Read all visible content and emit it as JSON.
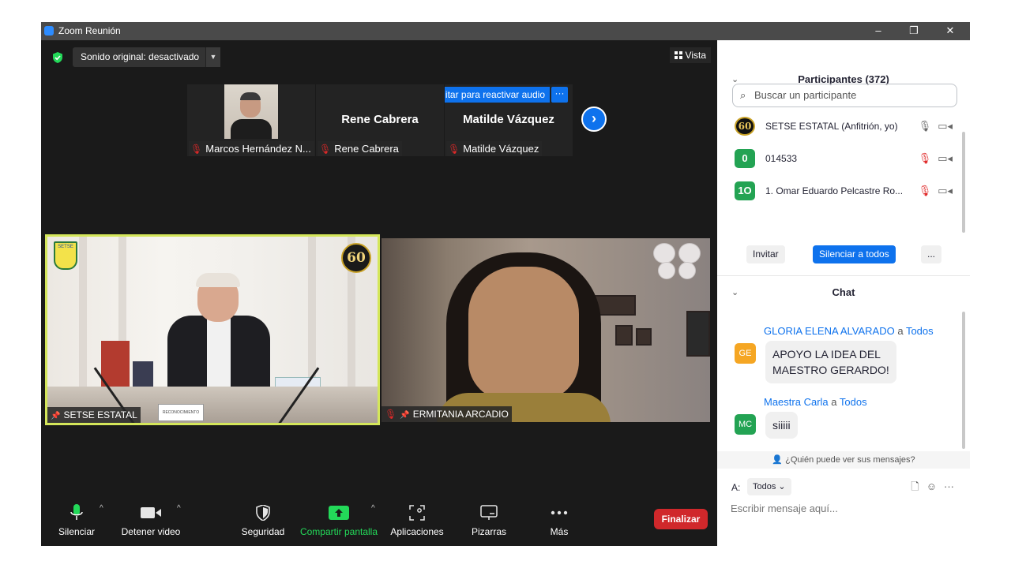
{
  "window": {
    "title": "Zoom Reunión",
    "controls": [
      "–",
      "❐",
      "✕"
    ]
  },
  "meeting": {
    "sound_button": "Sonido original: desactivado",
    "view_button": "Vista",
    "unmute_banner": "itar para reactivar audio",
    "more": "···",
    "thumbnails": [
      {
        "label": "Marcos Hernández N...",
        "big_name": ""
      },
      {
        "label": "Rene Cabrera",
        "big_name": "Rene Cabrera"
      },
      {
        "label": "Matilde Vázquez",
        "big_name": "Matilde Vázquez"
      }
    ],
    "videos": [
      {
        "label": "SETSE ESTATAL",
        "badge": "60",
        "logo_text": "SETSE",
        "poster_text": "RECONOCIMIENTO"
      },
      {
        "label": "ERMITANIA ARCADIO"
      }
    ]
  },
  "toolbar": {
    "items": [
      {
        "label": "Silenciar",
        "icon": "microphone-icon"
      },
      {
        "label": "Detener video",
        "icon": "video-camera-icon"
      },
      {
        "label": "Seguridad",
        "icon": "shield-icon"
      },
      {
        "label": "Compartir pantalla",
        "icon": "share-screen-icon"
      },
      {
        "label": "Aplicaciones",
        "icon": "apps-icon"
      },
      {
        "label": "Pizarras",
        "icon": "whiteboard-icon"
      },
      {
        "label": "Más",
        "icon": "more-icon"
      }
    ],
    "end_button": "Finalizar",
    "share_color": "#23d959",
    "end_color": "#d0282b"
  },
  "participants": {
    "title": "Participantes (372)",
    "search_placeholder": "Buscar un participante",
    "list": [
      {
        "avatar": "60",
        "name": "SETSE ESTATAL (Anfitrión, yo)",
        "avatar_color": "#111111",
        "muted": false
      },
      {
        "avatar": "0",
        "name": "014533",
        "avatar_color": "#23a353",
        "muted": true
      },
      {
        "avatar": "1O",
        "name": "1. Omar Eduardo Pelcastre Ro...",
        "avatar_color": "#23a353",
        "muted": true
      }
    ],
    "invite_button": "Invitar",
    "mute_all_button": "Silenciar a todos",
    "more_button": "..."
  },
  "chat": {
    "title": "Chat",
    "messages": [
      {
        "sender": "GLORIA ELENA ALVARADO",
        "connector": "a",
        "recipient": "Todos",
        "initials": "GE",
        "avatar_color": "#f5a623",
        "lines": [
          "APOYO LA IDEA DEL",
          "MAESTRO GERARDO!"
        ]
      },
      {
        "sender": "Maestra Carla",
        "connector": "a",
        "recipient": "Todos",
        "initials": "MC",
        "avatar_color": "#23a353",
        "lines": [
          "siiiii"
        ]
      }
    ],
    "who_can_see": "¿Quién puede ver sus mensajes?",
    "to_label": "A:",
    "to_value": "Todos",
    "input_placeholder": "Escribir mensaje aquí..."
  }
}
